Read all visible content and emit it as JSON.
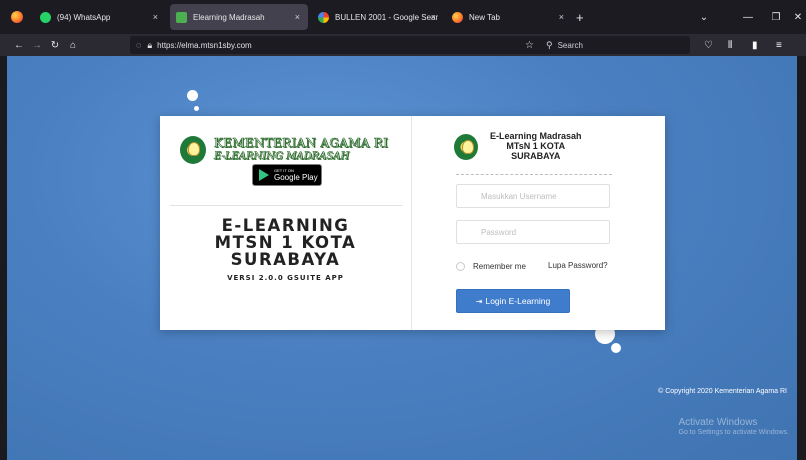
{
  "browser": {
    "tabs": [
      {
        "title": "(94) WhatsApp",
        "active": false,
        "favicon_color": "#25d366"
      },
      {
        "title": "Elearning Madrasah",
        "active": true,
        "favicon_color": "#4caf50"
      },
      {
        "title": "BULLEN 2001 - Google Search",
        "active": false,
        "favicon_color": "#ffffff"
      },
      {
        "title": "New Tab",
        "active": false,
        "favicon_color": "#ff7a2b"
      }
    ],
    "new_tab_label": "+",
    "close_glyph": "×",
    "url": "https://elma.mtsn1sby.com",
    "search_placeholder": "Search"
  },
  "login": {
    "brand_line1": "KEMENTERIAN AGAMA RI",
    "brand_line2": "E-LEARNING MADRASAH",
    "google_play_small": "GET IT ON",
    "google_play_big": "Google Play",
    "big_title_1": "E-LEARNING",
    "big_title_2": "MTSN 1 KOTA",
    "big_title_3": "SURABAYA",
    "version": "VERSI 2.0.0 GSUITE APP",
    "right_title_1": "E-Learning Madrasah",
    "right_title_2": "MTsN 1 KOTA",
    "right_title_3": "SURABAYA",
    "username_placeholder": "Masukkan Username",
    "password_placeholder": "Password",
    "remember_label": "Remember me",
    "forgot_label": "Lupa Password?",
    "login_label": "Login E-Learning"
  },
  "footer": {
    "copyright": "© Copyright 2020 Kementerian Agama RI",
    "activate_title": "Activate Windows",
    "activate_sub": "Go to Settings to activate Windows."
  },
  "colors": {
    "page_blue": "#4a80c2",
    "button_blue": "#3f7ccb",
    "browser_dark": "#1c1b22"
  }
}
